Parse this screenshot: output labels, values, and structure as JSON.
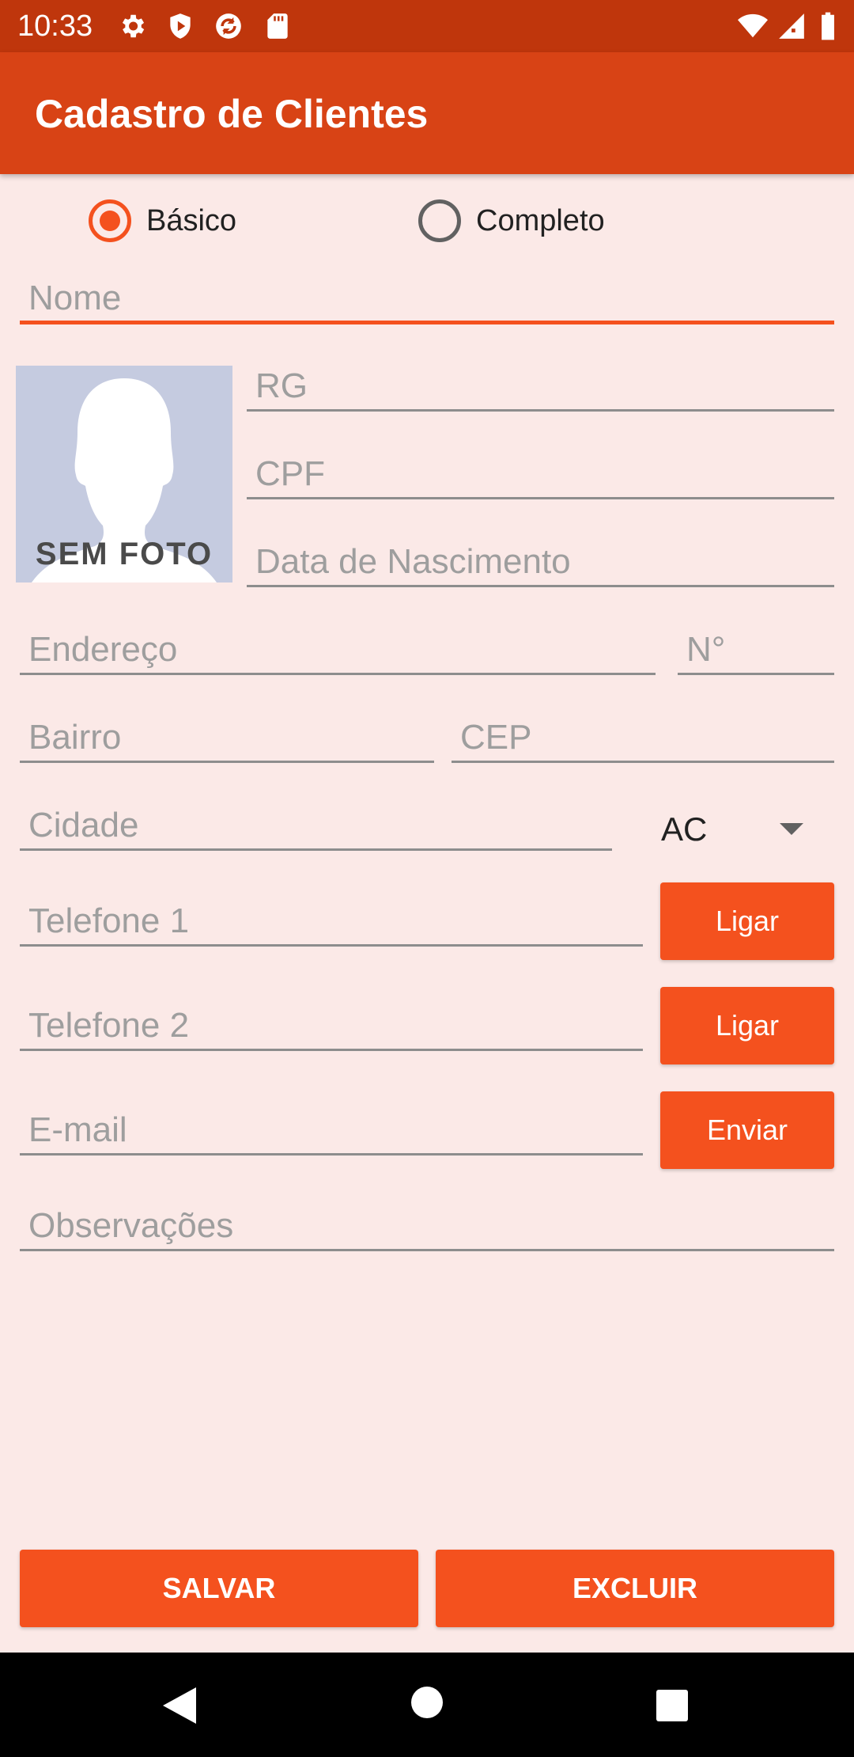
{
  "status_bar": {
    "time": "10:33",
    "icons": [
      "gear-icon",
      "shield-icon",
      "sync-icon",
      "sd-card-icon",
      "wifi-icon",
      "signal-icon",
      "battery-icon"
    ]
  },
  "app_bar": {
    "title": "Cadastro de Clientes"
  },
  "mode": {
    "options": [
      {
        "label": "Básico",
        "checked": true
      },
      {
        "label": "Completo",
        "checked": false
      }
    ]
  },
  "photo": {
    "label": "SEM FOTO"
  },
  "fields": {
    "nome": "Nome",
    "rg": "RG",
    "cpf": "CPF",
    "nascimento": "Data de Nascimento",
    "endereco": "Endereço",
    "numero": "N°",
    "bairro": "Bairro",
    "cep": "CEP",
    "cidade": "Cidade",
    "telefone1": "Telefone 1",
    "telefone2": "Telefone 2",
    "email": "E-mail",
    "observacoes": "Observações"
  },
  "state_spinner": {
    "value": "AC"
  },
  "buttons": {
    "ligar1": "Ligar",
    "ligar2": "Ligar",
    "enviar": "Enviar",
    "salvar": "SALVAR",
    "excluir": "EXCLUIR"
  },
  "colors": {
    "status_bar": "#bf360c",
    "app_bar": "#d84315",
    "accent": "#f4511e",
    "background": "#fbe9e7"
  },
  "nav": [
    "back-icon",
    "home-icon",
    "recents-icon"
  ]
}
